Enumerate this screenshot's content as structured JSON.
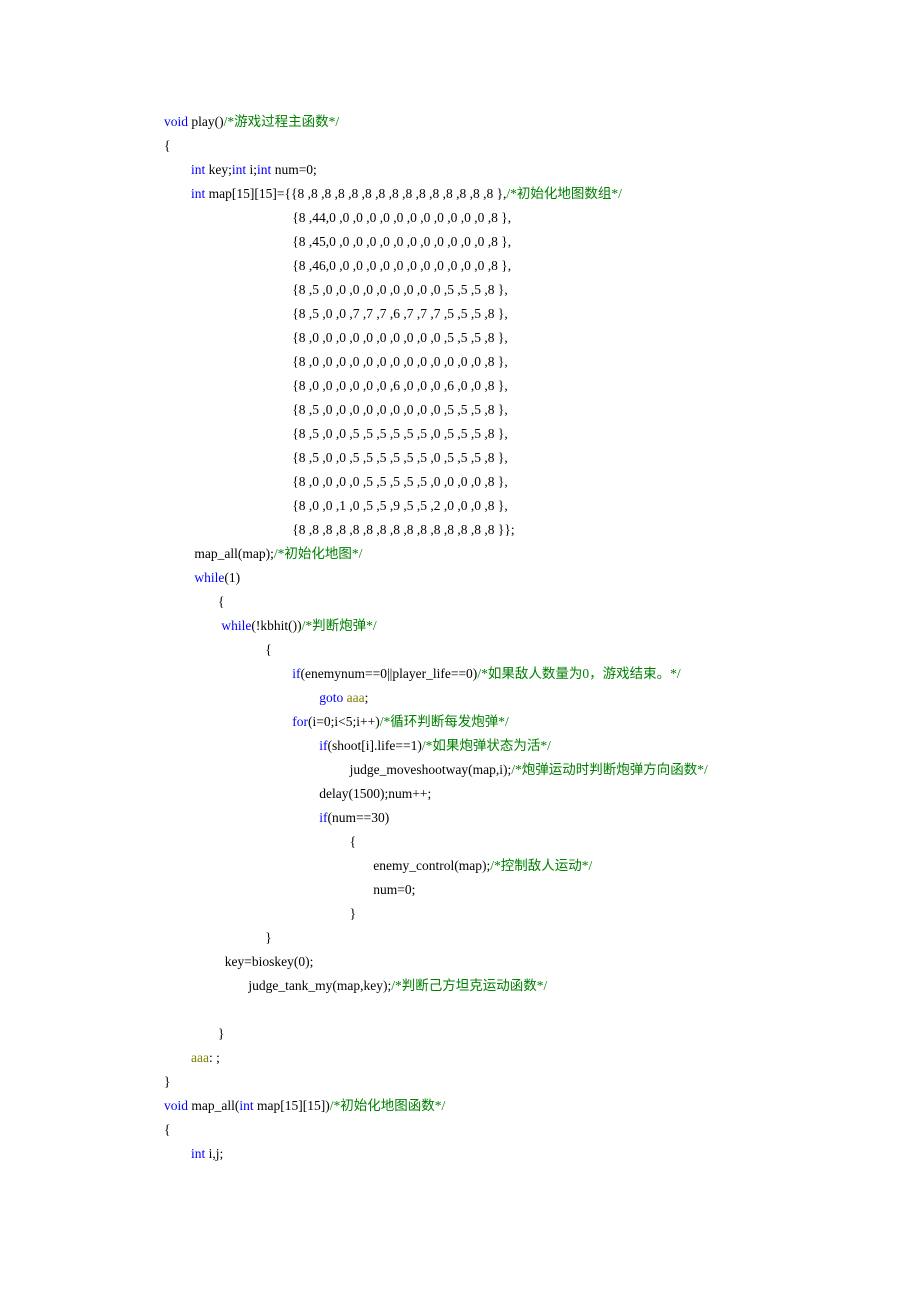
{
  "lines": [
    [
      {
        "c": "kw",
        "t": "void"
      },
      {
        "t": " play()"
      },
      {
        "c": "cm",
        "t": "/*游戏过程主函数*/"
      }
    ],
    [
      {
        "t": "{"
      }
    ],
    [
      {
        "t": "        "
      },
      {
        "c": "kw",
        "t": "int"
      },
      {
        "t": " key;"
      },
      {
        "c": "kw",
        "t": "int"
      },
      {
        "t": " i;"
      },
      {
        "c": "kw",
        "t": "int"
      },
      {
        "t": " num=0;"
      }
    ],
    [
      {
        "t": "        "
      },
      {
        "c": "kw",
        "t": "int"
      },
      {
        "t": " map[15][15]={{8 ,8 ,8 ,8 ,8 ,8 ,8 ,8 ,8 ,8 ,8 ,8 ,8 ,8 ,8 },"
      },
      {
        "c": "cm",
        "t": "/*初始化地图数组*/"
      }
    ],
    [
      {
        "t": "                                      {8 ,44,0 ,0 ,0 ,0 ,0 ,0 ,0 ,0 ,0 ,0 ,0 ,0 ,8 },"
      }
    ],
    [
      {
        "t": "                                      {8 ,45,0 ,0 ,0 ,0 ,0 ,0 ,0 ,0 ,0 ,0 ,0 ,0 ,8 },"
      }
    ],
    [
      {
        "t": "                                      {8 ,46,0 ,0 ,0 ,0 ,0 ,0 ,0 ,0 ,0 ,0 ,0 ,0 ,8 },"
      }
    ],
    [
      {
        "t": "                                      {8 ,5 ,0 ,0 ,0 ,0 ,0 ,0 ,0 ,0 ,0 ,5 ,5 ,5 ,8 },"
      }
    ],
    [
      {
        "t": "                                      {8 ,5 ,0 ,0 ,7 ,7 ,7 ,6 ,7 ,7 ,7 ,5 ,5 ,5 ,8 },"
      }
    ],
    [
      {
        "t": "                                      {8 ,0 ,0 ,0 ,0 ,0 ,0 ,0 ,0 ,0 ,0 ,5 ,5 ,5 ,8 },"
      }
    ],
    [
      {
        "t": "                                      {8 ,0 ,0 ,0 ,0 ,0 ,0 ,0 ,0 ,0 ,0 ,0 ,0 ,0 ,8 },"
      }
    ],
    [
      {
        "t": "                                      {8 ,0 ,0 ,0 ,0 ,0 ,0 ,6 ,0 ,0 ,0 ,6 ,0 ,0 ,8 },"
      }
    ],
    [
      {
        "t": "                                      {8 ,5 ,0 ,0 ,0 ,0 ,0 ,0 ,0 ,0 ,0 ,5 ,5 ,5 ,8 },"
      }
    ],
    [
      {
        "t": "                                      {8 ,5 ,0 ,0 ,5 ,5 ,5 ,5 ,5 ,5 ,0 ,5 ,5 ,5 ,8 },"
      }
    ],
    [
      {
        "t": "                                      {8 ,5 ,0 ,0 ,5 ,5 ,5 ,5 ,5 ,5 ,0 ,5 ,5 ,5 ,8 },"
      }
    ],
    [
      {
        "t": "                                      {8 ,0 ,0 ,0 ,0 ,5 ,5 ,5 ,5 ,5 ,0 ,0 ,0 ,0 ,8 },"
      }
    ],
    [
      {
        "t": "                                      {8 ,0 ,0 ,1 ,0 ,5 ,5 ,9 ,5 ,5 ,2 ,0 ,0 ,0 ,8 },"
      }
    ],
    [
      {
        "t": "                                      {8 ,8 ,8 ,8 ,8 ,8 ,8 ,8 ,8 ,8 ,8 ,8 ,8 ,8 ,8 }};"
      }
    ],
    [
      {
        "t": "         map_all(map);"
      },
      {
        "c": "cm",
        "t": "/*初始化地图*/"
      }
    ],
    [
      {
        "t": "         "
      },
      {
        "c": "kw",
        "t": "while"
      },
      {
        "t": "(1)"
      }
    ],
    [
      {
        "t": "                {"
      }
    ],
    [
      {
        "t": "                 "
      },
      {
        "c": "kw",
        "t": "while"
      },
      {
        "t": "(!kbhit())"
      },
      {
        "c": "cm",
        "t": "/*判断炮弹*/"
      }
    ],
    [
      {
        "t": "                              {"
      }
    ],
    [
      {
        "t": "                                      "
      },
      {
        "c": "kw",
        "t": "if"
      },
      {
        "t": "(enemynum==0||player_life==0)"
      },
      {
        "c": "cm",
        "t": "/*如果敌人数量为0，游戏结束。*/"
      }
    ],
    [
      {
        "t": "                                              "
      },
      {
        "c": "kw",
        "t": "goto"
      },
      {
        "t": " "
      },
      {
        "c": "lb",
        "t": "aaa"
      },
      {
        "t": ";"
      }
    ],
    [
      {
        "t": "                                      "
      },
      {
        "c": "kw",
        "t": "for"
      },
      {
        "t": "(i=0;i<5;i++)"
      },
      {
        "c": "cm",
        "t": "/*循环判断每发炮弹*/"
      }
    ],
    [
      {
        "t": "                                              "
      },
      {
        "c": "kw",
        "t": "if"
      },
      {
        "t": "(shoot[i].life==1)"
      },
      {
        "c": "cm",
        "t": "/*如果炮弹状态为活*/"
      }
    ],
    [
      {
        "t": "                                                       judge_moveshootway(map,i);"
      },
      {
        "c": "cm",
        "t": "/*炮弹运动时判断炮弹方向函数*/"
      }
    ],
    [
      {
        "t": "                                              delay(1500);num++;"
      }
    ],
    [
      {
        "t": "                                              "
      },
      {
        "c": "kw",
        "t": "if"
      },
      {
        "t": "(num==30)"
      }
    ],
    [
      {
        "t": "                                                       {"
      }
    ],
    [
      {
        "t": "                                                              enemy_control(map);"
      },
      {
        "c": "cm",
        "t": "/*控制敌人运动*/"
      }
    ],
    [
      {
        "t": "                                                              num=0;"
      }
    ],
    [
      {
        "t": "                                                       }"
      }
    ],
    [
      {
        "t": "                              }"
      }
    ],
    [
      {
        "t": "                  key=bioskey(0);"
      }
    ],
    [
      {
        "t": "                         judge_tank_my(map,key);"
      },
      {
        "c": "cm",
        "t": "/*判断己方坦克运动函数*/"
      }
    ],
    [
      {
        "t": ""
      }
    ],
    [
      {
        "t": "                }"
      }
    ],
    [
      {
        "t": "        "
      },
      {
        "c": "lb",
        "t": "aaa"
      },
      {
        "t": ": ;"
      }
    ],
    [
      {
        "t": "}"
      }
    ],
    [
      {
        "c": "kw",
        "t": "void"
      },
      {
        "t": " map_all("
      },
      {
        "c": "kw",
        "t": "int"
      },
      {
        "t": " map[15][15])"
      },
      {
        "c": "cm",
        "t": "/*初始化地图函数*/"
      }
    ],
    [
      {
        "t": "{"
      }
    ],
    [
      {
        "t": "        "
      },
      {
        "c": "kw",
        "t": "int"
      },
      {
        "t": " i,j;"
      }
    ]
  ]
}
